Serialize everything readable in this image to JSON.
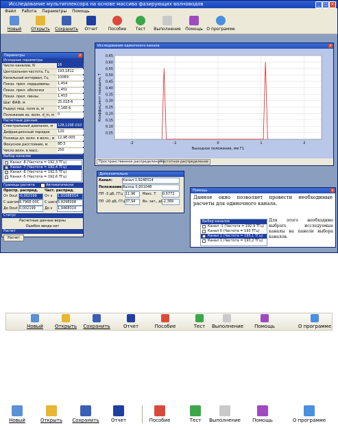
{
  "window": {
    "title": "Исследование мультиплексора на основе массива фазирующих волноводов",
    "controls": [
      "_",
      "□",
      "×"
    ]
  },
  "menu": [
    "Файл",
    "Работа",
    "Параметры",
    "Помощь"
  ],
  "toolbar": {
    "items": [
      {
        "label": "Новый",
        "icon": "new-doc-icon",
        "color": "#5b8fd6"
      },
      {
        "label": "Открыть",
        "icon": "open-folder-icon",
        "color": "#e8b630"
      },
      {
        "label": "Сохранить",
        "icon": "save-icon",
        "color": "#3b5fb5"
      },
      {
        "label": "Отчет",
        "icon": "word-report-icon",
        "color": "#1f3f9f"
      },
      {
        "label": "Пособие",
        "icon": "help-ring-icon",
        "color": "#d94a3a"
      },
      {
        "label": "Тест",
        "icon": "test-question-icon",
        "color": "#3aa84a"
      },
      {
        "label": "Выполнение",
        "icon": "execute-icon",
        "color": "#c9c9c9"
      },
      {
        "label": "Помощь",
        "icon": "help-pen-icon",
        "color": "#a04ac0"
      },
      {
        "label": "О программе",
        "icon": "about-question-icon",
        "color": "#4a8fe0"
      }
    ]
  },
  "params_panel": {
    "title": "Параметры",
    "section_input": "Исходные параметры",
    "inputs": [
      {
        "k": "Число каналов, N",
        "v": "16"
      },
      {
        "k": "Центральная частота, Гц",
        "v": "193,1E12"
      },
      {
        "k": "Канальный интервал, Гц",
        "v": "100E9"
      },
      {
        "k": "Показ. прел. сердцевины",
        "v": "1,454"
      },
      {
        "k": "Показ. прел. оболочки",
        "v": "1,451"
      },
      {
        "k": "Показ. прел. линзы",
        "v": "1,453"
      },
      {
        "k": "Шаг ФАФ, м",
        "v": "25,01E-6"
      },
      {
        "k": "Радиус мод. поля w, м",
        "v": "7,16E-6"
      },
      {
        "k": "Положение вх. волн. d_in, м",
        "v": "0"
      }
    ],
    "section_calc": "Расчетные данные",
    "calc": [
      {
        "k": "Спектральный диапазон, м",
        "v": "128,129E-010"
      },
      {
        "k": "Дифракционный порядок",
        "v": "120"
      },
      {
        "k": "Разница дл. волн. в волн., м",
        "v": "12,9E-005"
      },
      {
        "k": "Фокусное расстояние, м",
        "v": "8E-3"
      },
      {
        "k": "Число волн. в масс.",
        "v": "250"
      }
    ],
    "section_channels": "Выбор каналов",
    "channels": [
      {
        "label": "Канал -8 (Частота = 192,3 ТГц)",
        "checked": false,
        "selected": false
      },
      {
        "label": "Канал -7 (Частота = 192,4 ТГц)",
        "checked": true,
        "selected": true
      },
      {
        "label": "Канал -6 (Частота = 192,5 ТГц)",
        "checked": true,
        "selected": false
      },
      {
        "label": "Канал -5 (Частота = 192,6 ТГц)",
        "checked": false,
        "selected": false
      }
    ],
    "bounds_label": "Границы расчета",
    "auto_label": "Автоматически",
    "col_space": "Простр. распред.",
    "col_freq": "Част. распред.",
    "from_label": "От Dout",
    "from_val": "-0,002199",
    "from2_label": "От v",
    "from2_val": "1,9168E014",
    "step_label": "С шагом",
    "step_val": "8,796E-00C",
    "step2_label": "С шагом",
    "step2_val": "5,929E008",
    "to_label": "До Dout",
    "to_val": "0,002199",
    "to2_label": "До v",
    "to2_val": "1,946E014",
    "status_label": "Статус",
    "status_line1": "Расчетные данные верны",
    "status_line2": "Ошибок ввода нет",
    "calc_label": "Расчет",
    "calc_button": "Расчет"
  },
  "chart_window": {
    "title": "Исследование одиночного канала",
    "tabs": [
      "Пространственное распределение",
      "Частотное распределение"
    ]
  },
  "chart_data": {
    "type": "line",
    "ylabel": "Коэффициент передачи, Т",
    "xlabel": "Выходное положение, мм Г1",
    "xlim": [
      -2.4,
      2.4
    ],
    "ylim": [
      0,
      0.65
    ],
    "xticks": [
      -2,
      -1,
      0,
      1,
      2
    ],
    "yticks": [
      0.05,
      0.1,
      0.15,
      0.2,
      0.25,
      0.3,
      0.35,
      0.4,
      0.45,
      0.5,
      0.55,
      0.6,
      0.65
    ],
    "series": [
      {
        "points": [
          [
            -1.3,
            0
          ],
          [
            -1.25,
            0.55
          ],
          [
            -1.2,
            0
          ],
          [
            1.05,
            0
          ],
          [
            1.1,
            0.6
          ],
          [
            1.15,
            0
          ]
        ],
        "color": "#e02020"
      }
    ]
  },
  "extra_panel": {
    "title": "Дополнительно",
    "channel_label": "Канал:",
    "channel_value": "Канал 1,924E014",
    "position_label": "Положение:",
    "position_value": "Выход 0,001048",
    "pp3_label": "ПП -3 дБ, ГГц",
    "pp3_value": "11,96",
    "maxt_label": "Макс. Т",
    "maxt_value": "0,5772",
    "pp20_label": "ПП -20 дБ, ГГц",
    "pp20_value": "37,94",
    "vnzat_label": "Вн. зат., дБ",
    "vnzat_value": "-2,389"
  },
  "help_panel": {
    "title": "Помощь",
    "text_main": "Данное окно позволяет провести необходимые расчеты для одиночного канала.",
    "list_title": "Выбор каналов",
    "list": [
      {
        "label": "Канал -1 (Частота = 192,9 ТГц)",
        "selected": false
      },
      {
        "label": "Канал 0 (Частота = 193 ТГц)",
        "selected": false
      },
      {
        "label": "Канал 1 (Частота = 193,1 ТГц)",
        "selected": true
      },
      {
        "label": "Канал 1 (Частота = 193,2 ТГц)",
        "selected": false
      }
    ],
    "text_side": "Для этого необходимо выбрать исследуемые каналы на панели выбора каналов."
  },
  "toolbar2": {
    "items": [
      "Новый",
      "Открыть",
      "Сохранить",
      "Отчет",
      "Пособие",
      "Тест",
      "Выполнение",
      "Помощь",
      "О программе"
    ]
  },
  "toolbar3": {
    "items": [
      "Новый",
      "Открыть",
      "Сохранить",
      "Отчет",
      "Пособие",
      "Тест",
      "Выполнение",
      "Помощь",
      "О программе"
    ]
  }
}
